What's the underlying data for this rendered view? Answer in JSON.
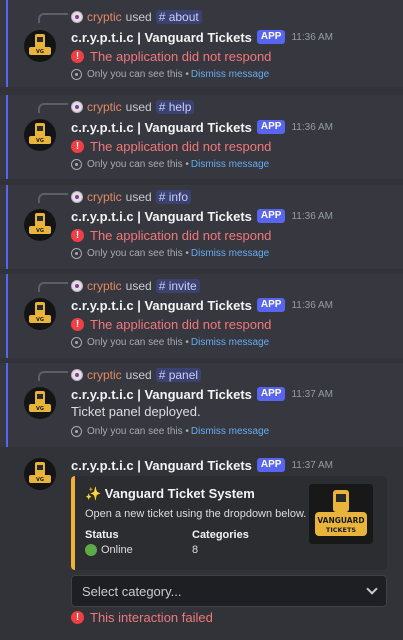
{
  "bot": {
    "name": "c.r.y.p.t.i.c | Vanguard Tickets",
    "tag": "APP",
    "logo_text": "VANGUARD TICKETS"
  },
  "user": {
    "name": "cryptic",
    "used": "used"
  },
  "messages": [
    {
      "command": "# about",
      "time": "11:36 AM",
      "error": "The application did not respond",
      "note": "Only you can see this •",
      "dismiss": "Dismiss message"
    },
    {
      "command": "# help",
      "time": "11:36 AM",
      "error": "The application did not respond",
      "note": "Only you can see this •",
      "dismiss": "Dismiss message"
    },
    {
      "command": "# info",
      "time": "11:36 AM",
      "error": "The application did not respond",
      "note": "Only you can see this •",
      "dismiss": "Dismiss message"
    },
    {
      "command": "# invite",
      "time": "11:36 AM",
      "error": "The application did not respond",
      "note": "Only you can see this •",
      "dismiss": "Dismiss message"
    },
    {
      "command": "# panel",
      "time": "11:37 AM",
      "body": "Ticket panel deployed.",
      "note": "Only you can see this •",
      "dismiss": "Dismiss message"
    }
  ],
  "panel_message": {
    "time": "11:37 AM",
    "embed": {
      "title": "✨ Vanguard Ticket System",
      "description": "Open a new ticket using the dropdown below.",
      "fields": [
        {
          "name": "Status",
          "value": "Online"
        },
        {
          "name": "Categories",
          "value": "8"
        }
      ],
      "accent_color": "#f0b232"
    },
    "select_placeholder": "Select category...",
    "error": "This interaction failed"
  },
  "colors": {
    "background": "#323339",
    "brand": "#5865f2",
    "error": "#f23f43",
    "link": "#66aaf0"
  }
}
